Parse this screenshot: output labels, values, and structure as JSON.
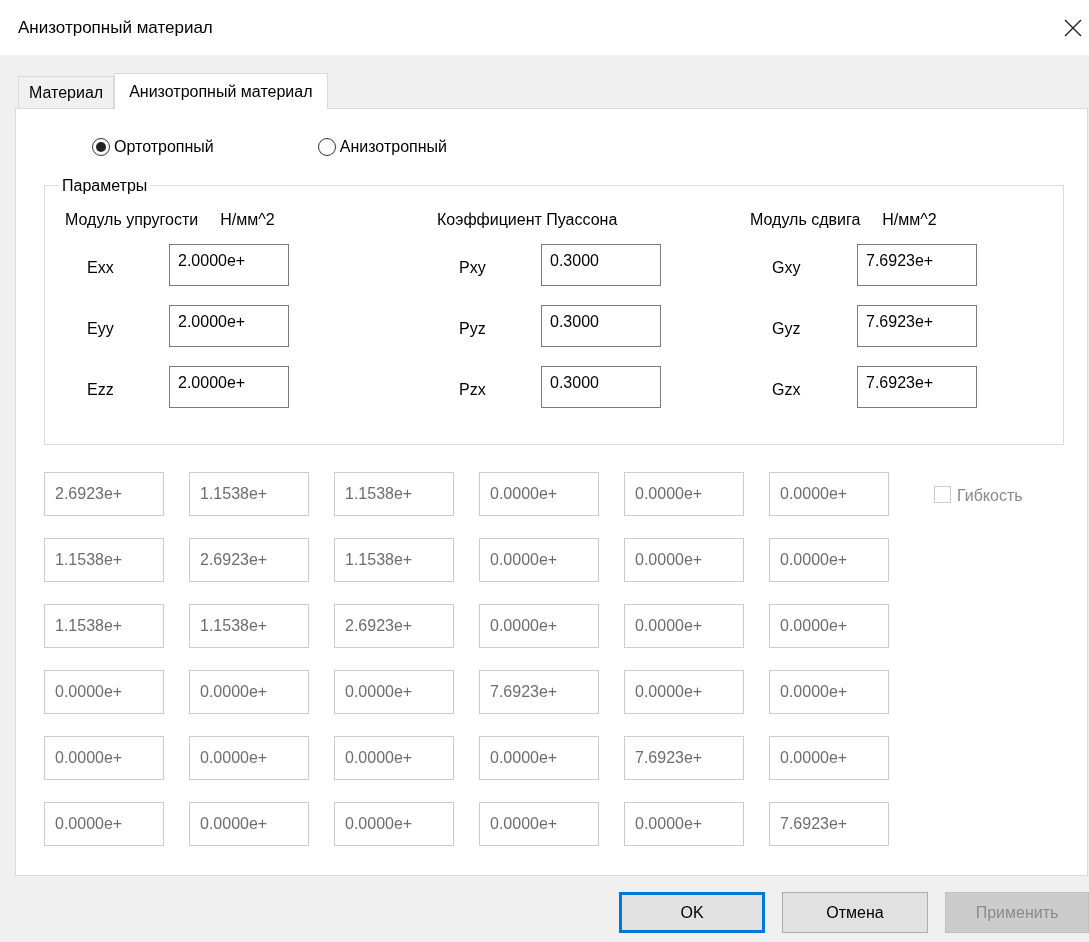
{
  "window": {
    "title": "Анизотропный материал"
  },
  "tabs": [
    {
      "label": "Материал",
      "selected": false
    },
    {
      "label": "Анизотропный материал",
      "selected": true
    }
  ],
  "mode": [
    {
      "label": "Ортотропный",
      "selected": true
    },
    {
      "label": "Анизотропный",
      "selected": false
    }
  ],
  "parameters": {
    "title": "Параметры",
    "columns": [
      {
        "heading": "Модуль упругости",
        "unit": "Н/мм^2",
        "fields": [
          {
            "label": "Exx",
            "value": "2.0000e+"
          },
          {
            "label": "Eyy",
            "value": "2.0000e+"
          },
          {
            "label": "Ezz",
            "value": "2.0000e+"
          }
        ]
      },
      {
        "heading": "Коэффициент Пуассона",
        "fields": [
          {
            "label": "Pxy",
            "value": "0.3000"
          },
          {
            "label": "Pyz",
            "value": "0.3000"
          },
          {
            "label": "Pzx",
            "value": "0.3000"
          }
        ]
      },
      {
        "heading": "Модуль сдвига",
        "unit": "Н/мм^2",
        "fields": [
          {
            "label": "Gxy",
            "value": "7.6923e+"
          },
          {
            "label": "Gyz",
            "value": "7.6923e+"
          },
          {
            "label": "Gzx",
            "value": "7.6923e+"
          }
        ]
      }
    ]
  },
  "matrix": {
    "disabled": true,
    "rows": [
      [
        "2.6923e+",
        "1.1538e+",
        "1.1538e+",
        "0.0000e+",
        "0.0000e+",
        "0.0000e+"
      ],
      [
        "1.1538e+",
        "2.6923e+",
        "1.1538e+",
        "0.0000e+",
        "0.0000e+",
        "0.0000e+"
      ],
      [
        "1.1538e+",
        "1.1538e+",
        "2.6923e+",
        "0.0000e+",
        "0.0000e+",
        "0.0000e+"
      ],
      [
        "0.0000e+",
        "0.0000e+",
        "0.0000e+",
        "7.6923e+",
        "0.0000e+",
        "0.0000e+"
      ],
      [
        "0.0000e+",
        "0.0000e+",
        "0.0000e+",
        "0.0000e+",
        "7.6923e+",
        "0.0000e+"
      ],
      [
        "0.0000e+",
        "0.0000e+",
        "0.0000e+",
        "0.0000e+",
        "0.0000e+",
        "7.6923e+"
      ]
    ]
  },
  "flexibility": {
    "label": "Гибкость",
    "checked": false,
    "disabled": true
  },
  "buttons": [
    {
      "label": "OK",
      "kind": "default"
    },
    {
      "label": "Отмена",
      "kind": "normal"
    },
    {
      "label": "Применить",
      "kind": "disabled"
    }
  ]
}
